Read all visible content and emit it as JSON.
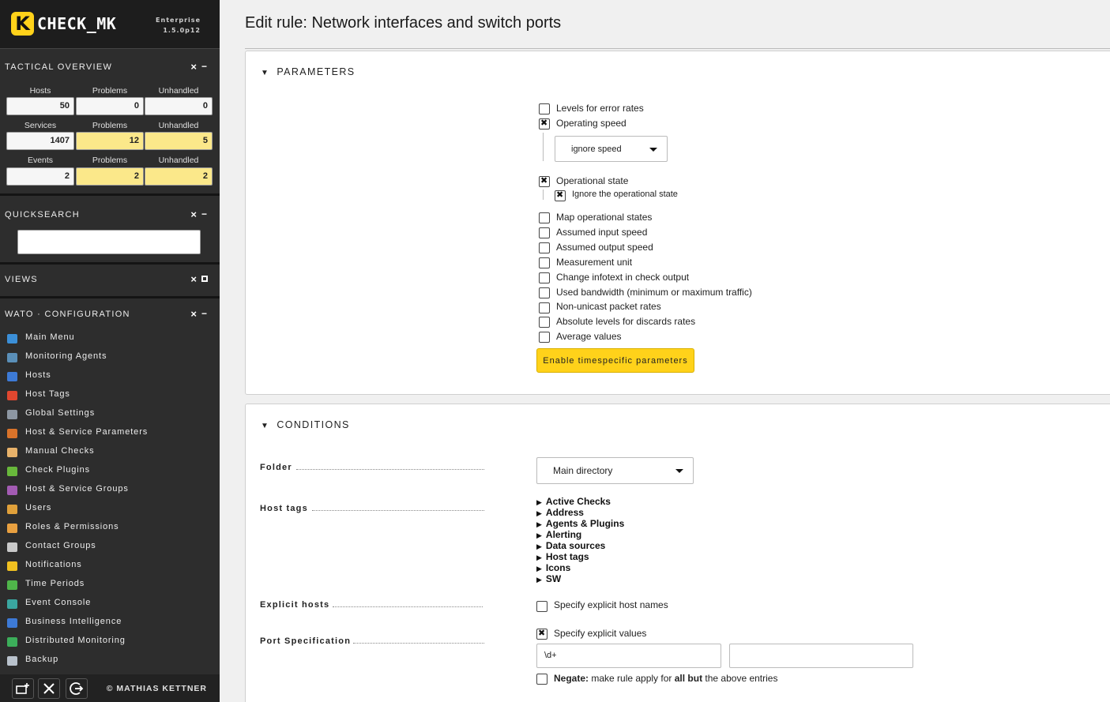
{
  "app": {
    "logo_letter": "K",
    "logo_text": "CHECK_MK",
    "edition": "Enterprise",
    "version": "1.5.0p12"
  },
  "snapins": {
    "tactical_overview": {
      "title": "TACTICAL OVERVIEW",
      "close_label": "×",
      "minimize_label": "−",
      "rows": [
        {
          "label": "Hosts",
          "value": "50",
          "problems_label": "Problems",
          "problems": "0",
          "unhandled_label": "Unhandled",
          "unhandled": "0"
        },
        {
          "label": "Services",
          "value": "1407",
          "problems_label": "Problems",
          "problems": "12",
          "unhandled_label": "Unhandled",
          "unhandled": "5"
        },
        {
          "label": "Events",
          "value": "2",
          "problems_label": "Problems",
          "problems": "2",
          "unhandled_label": "Unhandled",
          "unhandled": "2"
        }
      ]
    },
    "quicksearch": {
      "title": "QUICKSEARCH",
      "close_label": "×",
      "minimize_label": "−",
      "value": ""
    },
    "views": {
      "title": "VIEWS",
      "close_label": "×"
    },
    "wato": {
      "title": "WATO · CONFIGURATION",
      "close_label": "×",
      "minimize_label": "−",
      "items": [
        {
          "label": "Main Menu",
          "icon": "main-menu-icon",
          "color": "#3b8fd8"
        },
        {
          "label": "Monitoring Agents",
          "icon": "agents-icon",
          "color": "#5a8fb8"
        },
        {
          "label": "Hosts",
          "icon": "hosts-icon",
          "color": "#3d7ad6"
        },
        {
          "label": "Host Tags",
          "icon": "host-tags-icon",
          "color": "#e0472f"
        },
        {
          "label": "Global Settings",
          "icon": "gear-icon",
          "color": "#8d97a3"
        },
        {
          "label": "Host & Service Parameters",
          "icon": "rulesets-icon",
          "color": "#d9732a"
        },
        {
          "label": "Manual Checks",
          "icon": "hand-icon",
          "color": "#e8b26a"
        },
        {
          "label": "Check Plugins",
          "icon": "puzzle-icon",
          "color": "#68b83b"
        },
        {
          "label": "Host & Service Groups",
          "icon": "groups-icon",
          "color": "#a35bb3"
        },
        {
          "label": "Users",
          "icon": "users-icon",
          "color": "#e0a03a"
        },
        {
          "label": "Roles & Permissions",
          "icon": "roles-icon",
          "color": "#e8a040"
        },
        {
          "label": "Contact Groups",
          "icon": "contact-groups-icon",
          "color": "#c9c9c9"
        },
        {
          "label": "Notifications",
          "icon": "bell-icon",
          "color": "#f0c020"
        },
        {
          "label": "Time Periods",
          "icon": "clock-icon",
          "color": "#4fb54a"
        },
        {
          "label": "Event Console",
          "icon": "event-console-icon",
          "color": "#3aa6a0"
        },
        {
          "label": "Business Intelligence",
          "icon": "bi-icon",
          "color": "#3d7ad6"
        },
        {
          "label": "Distributed Monitoring",
          "icon": "globe-icon",
          "color": "#3cae5a"
        },
        {
          "label": "Backup",
          "icon": "backup-icon",
          "color": "#b9c2cc"
        }
      ]
    },
    "footer": {
      "buttons": [
        {
          "name": "add-snapin-button",
          "icon": "add-snapin-icon",
          "glyph": "➕"
        },
        {
          "name": "settings-button",
          "icon": "tools-icon",
          "glyph": "✖"
        },
        {
          "name": "logout-button",
          "icon": "logout-icon",
          "glyph": "↪"
        }
      ],
      "copyright": "© MATHIAS KETTNER"
    }
  },
  "main": {
    "title": "Edit rule: Network interfaces and switch ports",
    "parameters": {
      "heading": "PARAMETERS",
      "options": [
        {
          "label": "Levels for error rates",
          "checked": false
        },
        {
          "label": "Operating speed",
          "checked": true
        },
        {
          "label": "Operational state",
          "checked": true
        },
        {
          "label": "Map operational states",
          "checked": false
        },
        {
          "label": "Assumed input speed",
          "checked": false
        },
        {
          "label": "Assumed output speed",
          "checked": false
        },
        {
          "label": "Measurement unit",
          "checked": false
        },
        {
          "label": "Change infotext in check output",
          "checked": false
        },
        {
          "label": "Used bandwidth (minimum or maximum traffic)",
          "checked": false
        },
        {
          "label": "Non-unicast packet rates",
          "checked": false
        },
        {
          "label": "Absolute levels for discards rates",
          "checked": false
        },
        {
          "label": "Average values",
          "checked": false
        }
      ],
      "speed_select_value": "ignore speed",
      "ignore_state_label": "Ignore the operational state",
      "ignore_state_checked": true,
      "timespecific_button": "Enable timespecific parameters"
    },
    "conditions": {
      "heading": "CONDITIONS",
      "folder_label": "Folder",
      "folder_value": "Main directory",
      "host_tags_label": "Host tags",
      "host_tags": [
        "Active Checks",
        "Address",
        "Agents & Plugins",
        "Alerting",
        "Data sources",
        "Host tags",
        "Icons",
        "SW"
      ],
      "explicit_hosts_label": "Explicit hosts",
      "explicit_hosts_checkbox": "Specify explicit host names",
      "explicit_hosts_checked": false,
      "port_spec_label": "Port Specification",
      "port_spec_checkbox": "Specify explicit values",
      "port_spec_checked": true,
      "port_value_1": "\\d+",
      "port_value_2": "",
      "negate_bold": "Negate:",
      "negate_text_1": " make rule apply for ",
      "negate_text_bold2": "all but",
      "negate_text_2": " the above entries",
      "negate_checked": false
    }
  }
}
